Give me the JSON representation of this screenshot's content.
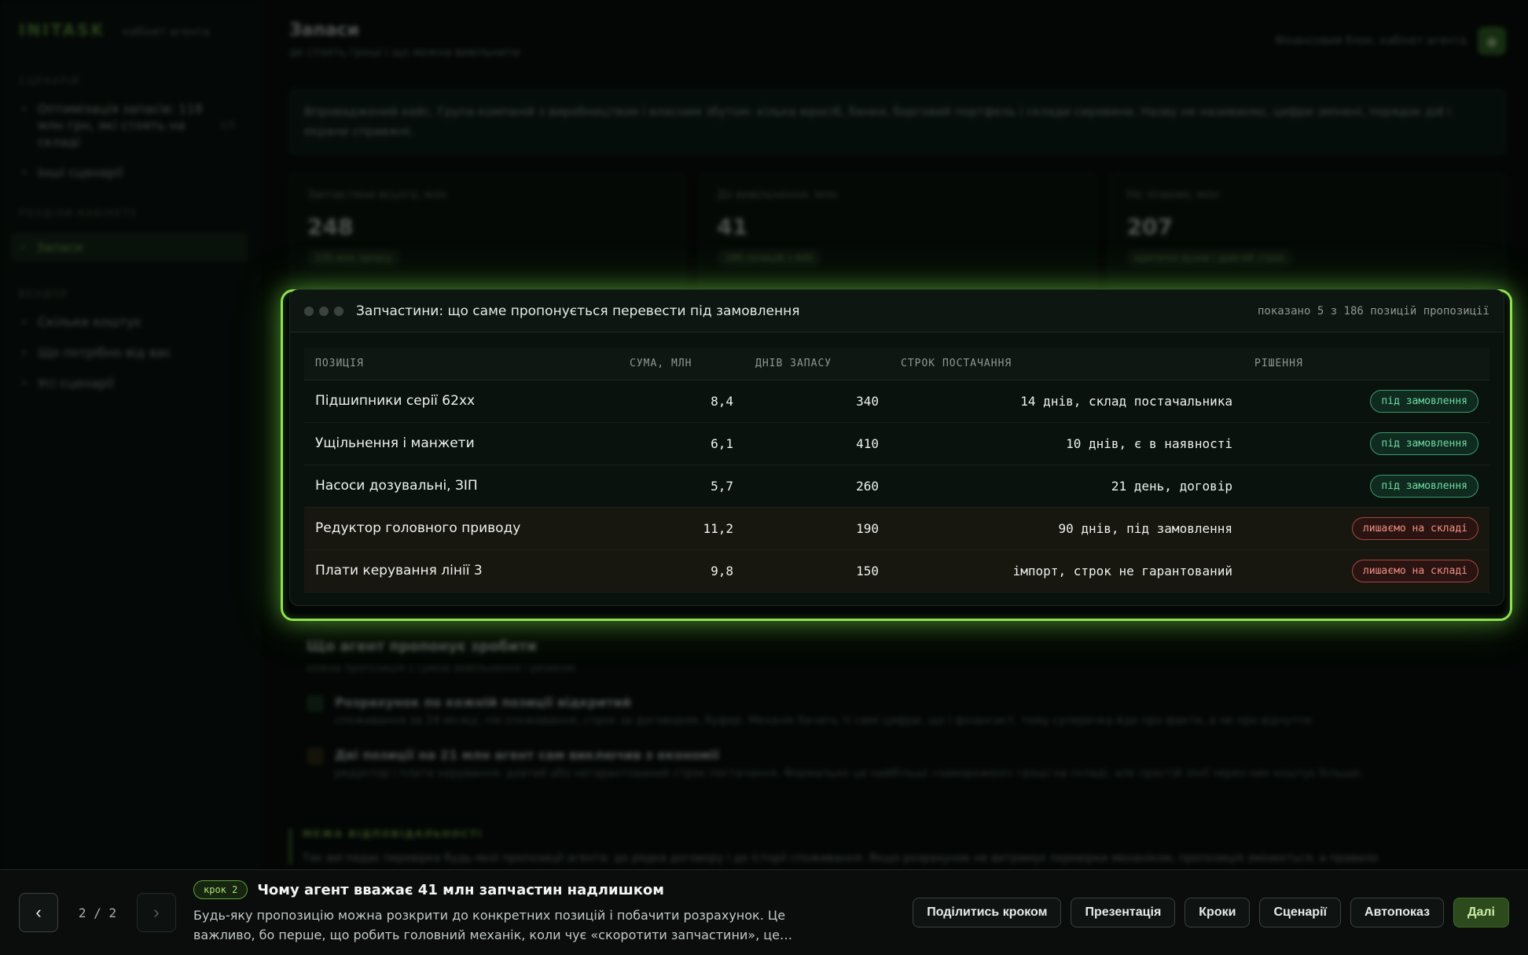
{
  "sidebar": {
    "logo": "INITASK",
    "logo_sub": "кабінет агента",
    "sections": [
      {
        "label": "СЦЕНАРІЙ",
        "items": [
          {
            "label": "Оптимізація запасів: 118 млн грн, які стоять на складі",
            "count": "1/3"
          },
          {
            "label": "Інші сценарії"
          }
        ]
      },
      {
        "label": "РОЗДІЛИ КАБІНЕТУ",
        "items": [
          {
            "label": "Запаси",
            "active": true
          }
        ]
      },
      {
        "label": "ВЕНДОР",
        "items": [
          {
            "label": "Скільки коштує"
          },
          {
            "label": "Що потрібно від вас"
          },
          {
            "label": "Усі сценарії"
          }
        ]
      }
    ]
  },
  "header": {
    "title": "Запаси",
    "subtitle": "де стоять гроші і що можна вивільнити",
    "account": "Фінансовий блок, кабінет агента",
    "avatar_icon": "user-icon"
  },
  "callout": "Впроваджений кейс. Група компаній з виробництвом і власним збутом: кілька юросіб, банки, борговий портфель і склади сировини. Назву не називаємо, цифри змінені, порядок дій і екрани справжні.",
  "kpis": [
    {
      "label": "Запчастини всього, млн",
      "value": "248",
      "tag": "235 млн запасу"
    },
    {
      "label": "До вивільнення, млн",
      "value": "41",
      "tag": "186 позицій з 640"
    },
    {
      "label": "Не чіпаємо, млн",
      "value": "207",
      "tag": "критичні вузли і довгий строк"
    }
  ],
  "panel": {
    "title": "Запчастини: що саме пропонується перевести під замовлення",
    "meta": "показано 5 з 186 позицій пропозиції",
    "columns": [
      "ПОЗИЦІЯ",
      "СУМА, МЛН",
      "ДНІВ ЗАПАСУ",
      "СТРОК ПОСТАЧАННЯ",
      "РІШЕННЯ"
    ],
    "rows": [
      {
        "item": "Підшипники серії 62хх",
        "sum": "8,4",
        "days": "340",
        "term": "14 днів, склад постачальника",
        "decision": "під замовлення",
        "kind": "order"
      },
      {
        "item": "Ущільнення і манжети",
        "sum": "6,1",
        "days": "410",
        "term": "10 днів, є в наявності",
        "decision": "під замовлення",
        "kind": "order"
      },
      {
        "item": "Насоси дозувальні, ЗІП",
        "sum": "5,7",
        "days": "260",
        "term": "21 день, договір",
        "decision": "під замовлення",
        "kind": "order"
      },
      {
        "item": "Редуктор головного приводу",
        "sum": "11,2",
        "days": "190",
        "term": "90 днів, під замовлення",
        "decision": "лишаємо на складі",
        "kind": "keep"
      },
      {
        "item": "Плати керування лінії 3",
        "sum": "9,8",
        "days": "150",
        "term": "імпорт, строк не гарантований",
        "decision": "лишаємо на складі",
        "kind": "keep"
      }
    ]
  },
  "below": {
    "title": "Що агент пропонує зробити",
    "subtitle": "кожна пропозиція з сумою вивільнення і ризиком",
    "points": [
      {
        "title": "Розрахунок по кожній позиції відкритий",
        "text": "споживання за 24 місяці, пік споживання, строк за договором, буфер. Механік бачить ті самі цифри, що і фінансист, тому суперечка йде про факти, а не про відчуття."
      },
      {
        "title": "Дві позиції на 21 млн агент сам виключив з економії",
        "text": "редуктор і плати керування: довгий або негарантований строк постачання. Формально це найбільші «заморожені» гроші на складі, але простій лінії через них коштує більше."
      }
    ]
  },
  "responsibility": {
    "label": "МЕЖА ВІДПОВІДАЛЬНОСТІ",
    "text": "Так виглядає перевірка будь-якої пропозиції агента: до рядка договору і до історії споживання. Якщо розрахунок не витримує перевірки механіком, пропозиція змінюється, а правило"
  },
  "tour": {
    "counter": "2 / 2",
    "prev_icon": "chevron-left-icon",
    "next_icon": "chevron-right-icon",
    "prev_glyph": "‹",
    "next_glyph": "›",
    "step_badge": "крок 2",
    "step_title": "Чому агент вважає 41 млн запчастин надлишком",
    "step_text": "Будь-яку пропозицію можна розкрити до конкретних позицій і побачити розрахунок. Це важливо, бо перше, що робить головний механік, коли чує «скоротити запчастини», це…",
    "actions": [
      "Поділитись кроком",
      "Презентація",
      "Кроки",
      "Сценарії",
      "Автопоказ"
    ],
    "primary": "Далі"
  },
  "colors": {
    "accent": "#8fe04f",
    "order": "#6fdaa3",
    "keep": "#f08f83"
  }
}
